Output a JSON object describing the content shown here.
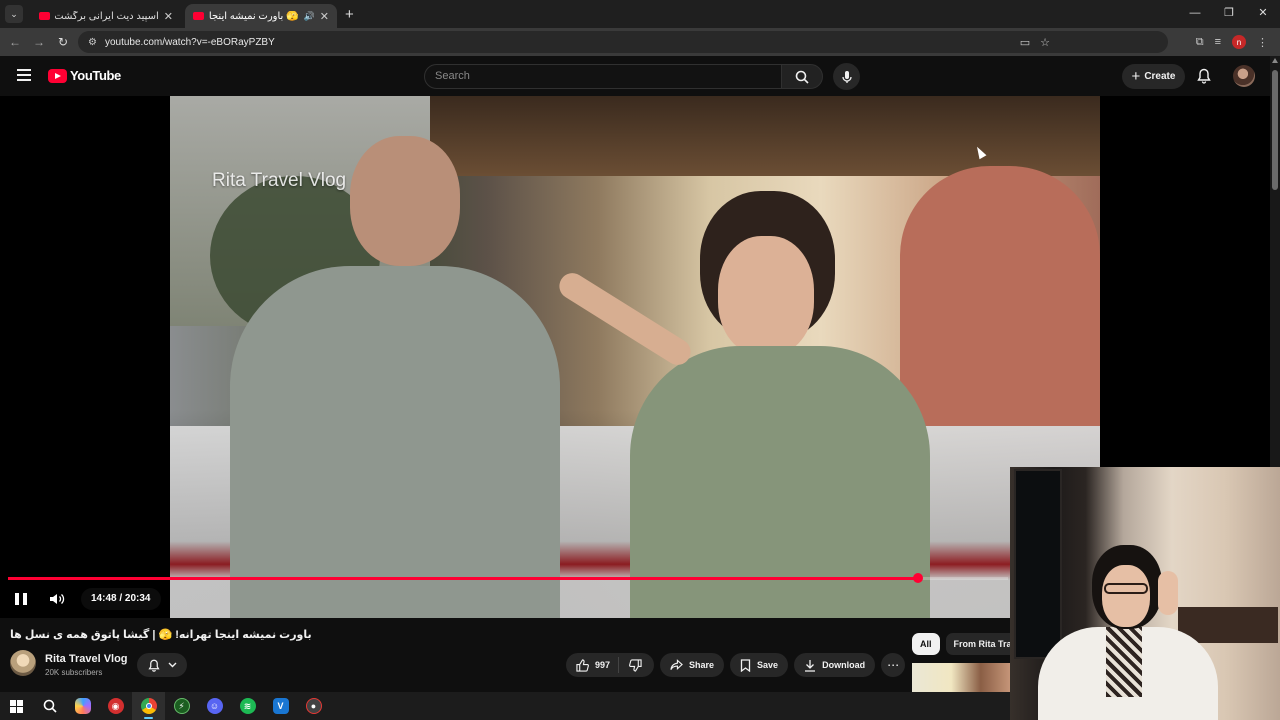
{
  "browser": {
    "tabs": [
      {
        "title": "اسپید دیت ایرانی برگشت ✅ ...",
        "active": false
      },
      {
        "title": "🫣 باورت نمیشه اینجا تهرانه! ...",
        "active": true
      }
    ],
    "tab_close": "✕",
    "new_tab": "+",
    "window_controls": {
      "minimize": "—",
      "restore": "❐",
      "close": "✕"
    },
    "url": "youtube.com/watch?v=-eBORayPZBY",
    "profile_initial": "n"
  },
  "youtube": {
    "logo_text": "YouTube",
    "search_placeholder": "Search",
    "create_label": "Create",
    "create_plus": "+"
  },
  "player": {
    "watermark": "Rita Travel Vlog",
    "time": "14:48 / 20:34",
    "progress": 0.91
  },
  "video": {
    "title": "باورت نمیشه اینجا تهرانه! 🫣 | گیشا پاتوق همه ی نسل ها",
    "channel_name": "Rita Travel Vlog",
    "subscribers": "20K subscribers",
    "likes": "997",
    "share_label": "Share",
    "save_label": "Save",
    "download_label": "Download",
    "more_label": "⋯"
  },
  "chips": [
    {
      "label": "All",
      "selected": true
    },
    {
      "label": "From Rita Tra",
      "selected": false
    }
  ],
  "colors": {
    "accent": "#ff0033",
    "background": "#0f0f0f",
    "surface": "#272727",
    "taskbar": "#1c1c1c"
  },
  "taskbar": {
    "icons": [
      "windows-start-icon",
      "search-icon",
      "copilot-icon",
      "app-red-icon",
      "chrome-icon",
      "app-green-icon",
      "discord-icon",
      "spotify-icon",
      "app-blue-icon",
      "app-chrome-record-icon"
    ]
  }
}
